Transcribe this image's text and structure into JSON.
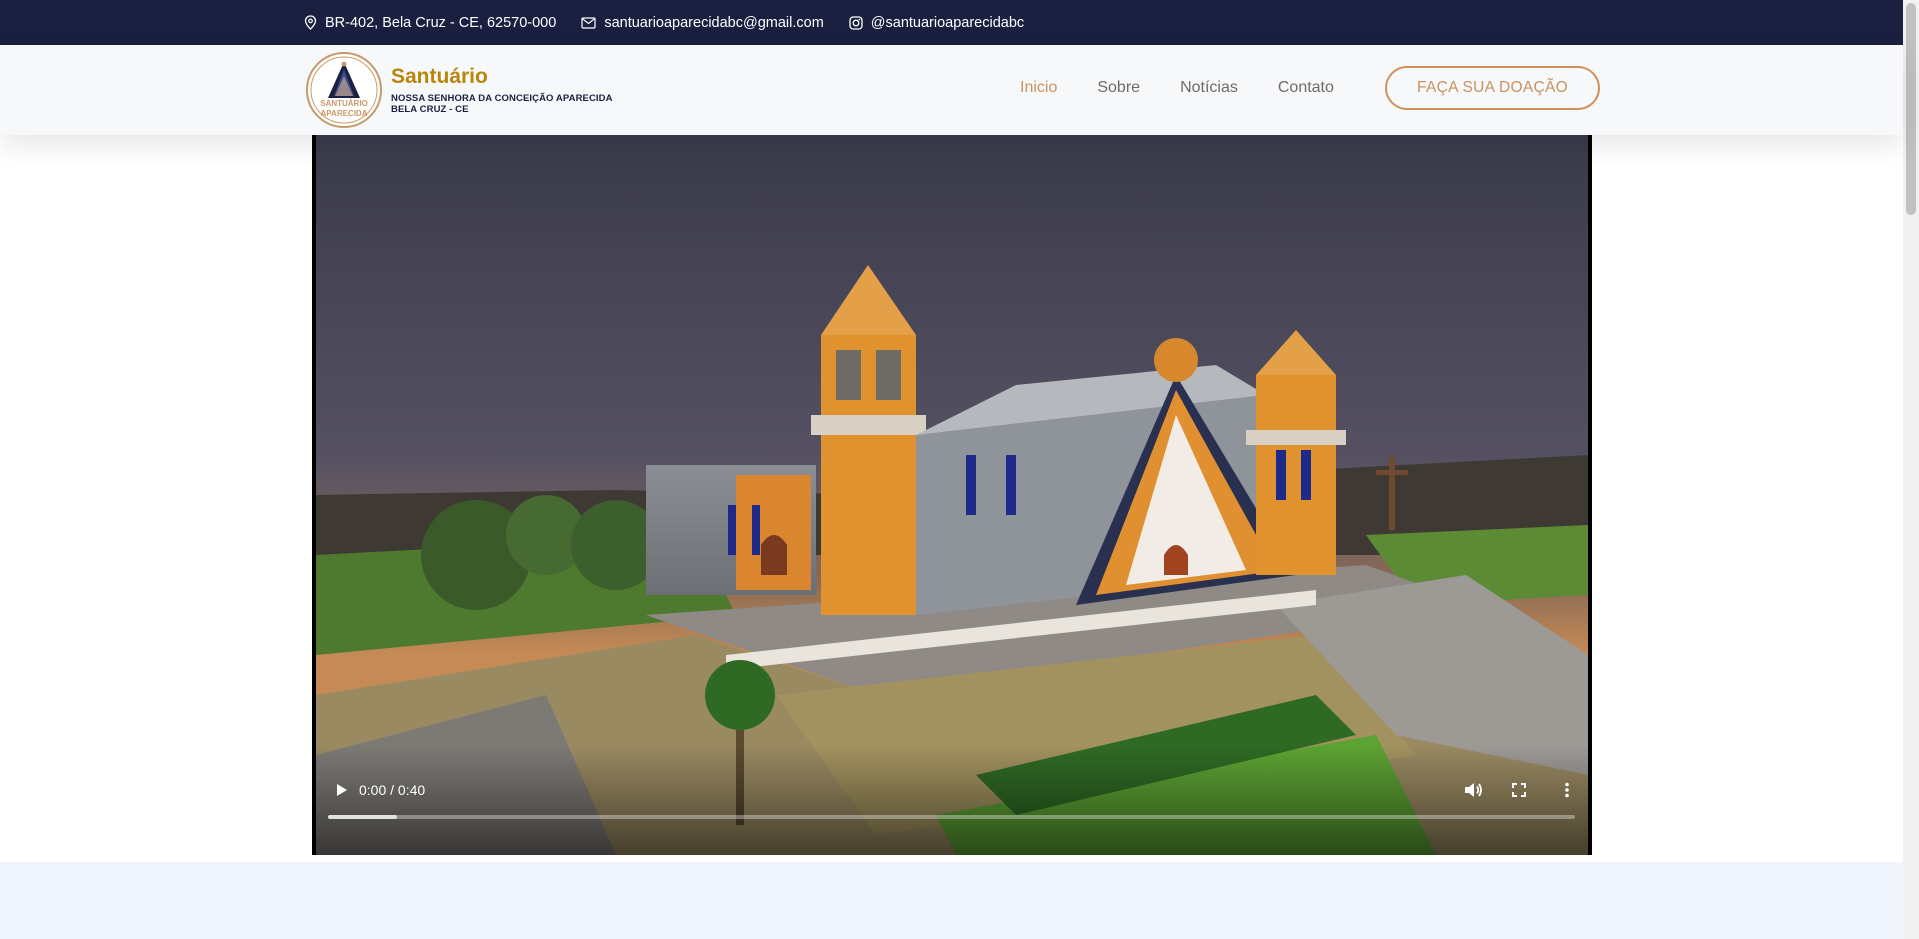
{
  "topbar": {
    "address": "BR-402, Bela Cruz - CE, 62570-000",
    "email": "santuarioaparecidabc@gmail.com",
    "instagram": "@santuarioaparecidabc"
  },
  "header": {
    "brand_title": "Santuário",
    "brand_subtitle_line1": "NOSSA SENHORA DA CONCEIÇÃO APARECIDA",
    "brand_subtitle_line2": "BELA CRUZ - CE",
    "logo_text_top": "SANTUÁRIO",
    "logo_text_bottom": "APARECIDA",
    "nav": [
      {
        "label": "Inicio",
        "active": true
      },
      {
        "label": "Sobre",
        "active": false
      },
      {
        "label": "Notícias",
        "active": false
      },
      {
        "label": "Contato",
        "active": false
      }
    ],
    "donate_label": "FAÇA SUA DOAÇÃO"
  },
  "video": {
    "time_display": "0:00 / 0:40",
    "buffered_fraction": 0.055,
    "icons": [
      "play-icon",
      "volume-icon",
      "fullscreen-icon",
      "more-vert-icon"
    ]
  },
  "colors": {
    "topbar_bg": "#1b2040",
    "accent": "#c9925f",
    "brand_gold": "#b8860b",
    "section_bg": "#f0f5fd"
  }
}
